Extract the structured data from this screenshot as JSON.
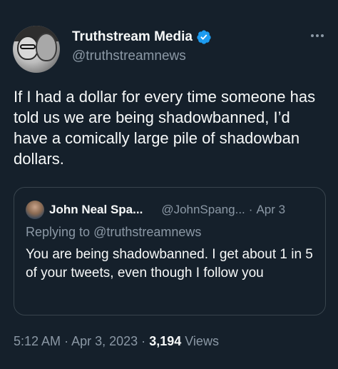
{
  "author": {
    "display_name": "Truthstream Media",
    "handle": "@truthstreamnews",
    "verified": true,
    "avatar_icon": "profile-photo"
  },
  "tweet": {
    "text": "If I had a dollar for every time someone has told us we are being shadowbanned, I’d have a comically large pile of shadowban dollars."
  },
  "quoted": {
    "display_name": "John Neal Spa...",
    "handle": "@JohnSpang...",
    "separator": "·",
    "date": "Apr 3",
    "replying_prefix": "Replying to",
    "replying_to": "@truthstreamnews",
    "text": "You are being shadowbanned. I get about 1 in 5 of your tweets, even though I follow you"
  },
  "meta": {
    "time": "5:12 AM",
    "sep1": "·",
    "date": "Apr 3, 2023",
    "sep2": "·",
    "views_count": "3,194",
    "views_label": "Views"
  },
  "colors": {
    "background": "#15202b",
    "primary_text": "#f7f9f9",
    "secondary_text": "#8b98a5",
    "verified": "#1d9bf0",
    "border": "#38444d"
  }
}
